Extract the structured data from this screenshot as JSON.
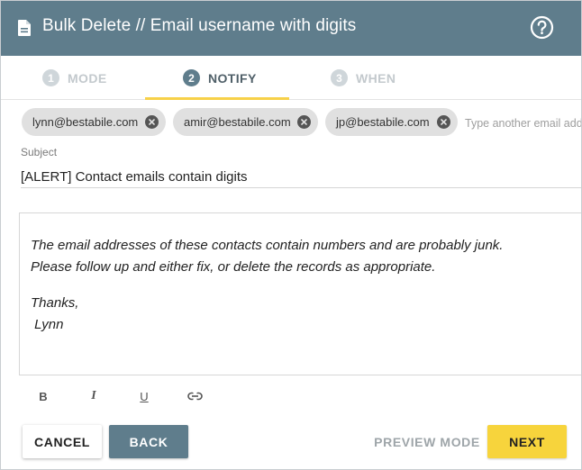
{
  "header": {
    "title": "Bulk Delete // Email username with digits",
    "doc_icon": "document-icon",
    "help_icon": "help-circle-icon",
    "bg_color": "#5f7d8c"
  },
  "stepper": {
    "steps": [
      {
        "number": "1",
        "label": "MODE",
        "state": "inactive"
      },
      {
        "number": "2",
        "label": "NOTIFY",
        "state": "active"
      },
      {
        "number": "3",
        "label": "WHEN",
        "state": "inactive"
      }
    ],
    "accent_color": "#f7d149"
  },
  "recipients": {
    "chips": [
      {
        "email": "lynn@bestabile.com"
      },
      {
        "email": "amir@bestabile.com"
      },
      {
        "email": "jp@bestabile.com"
      }
    ],
    "placeholder": "Type another email address"
  },
  "subject": {
    "label": "Subject",
    "value": "[ALERT] Contact emails contain digits"
  },
  "message": {
    "line1": "The email addresses of these contacts contain numbers and are probably junk.",
    "line2": "Please follow up and either fix, or delete the records as appropriate.",
    "line3": "Thanks,",
    "line4": " Lynn"
  },
  "format_toolbar": {
    "bold": "B",
    "italic": "I",
    "underline": "U",
    "link_icon": "link-icon"
  },
  "actions": {
    "cancel": "CANCEL",
    "back": "BACK",
    "preview": "PREVIEW MODE",
    "next": "NEXT",
    "next_color": "#f7d43c"
  }
}
